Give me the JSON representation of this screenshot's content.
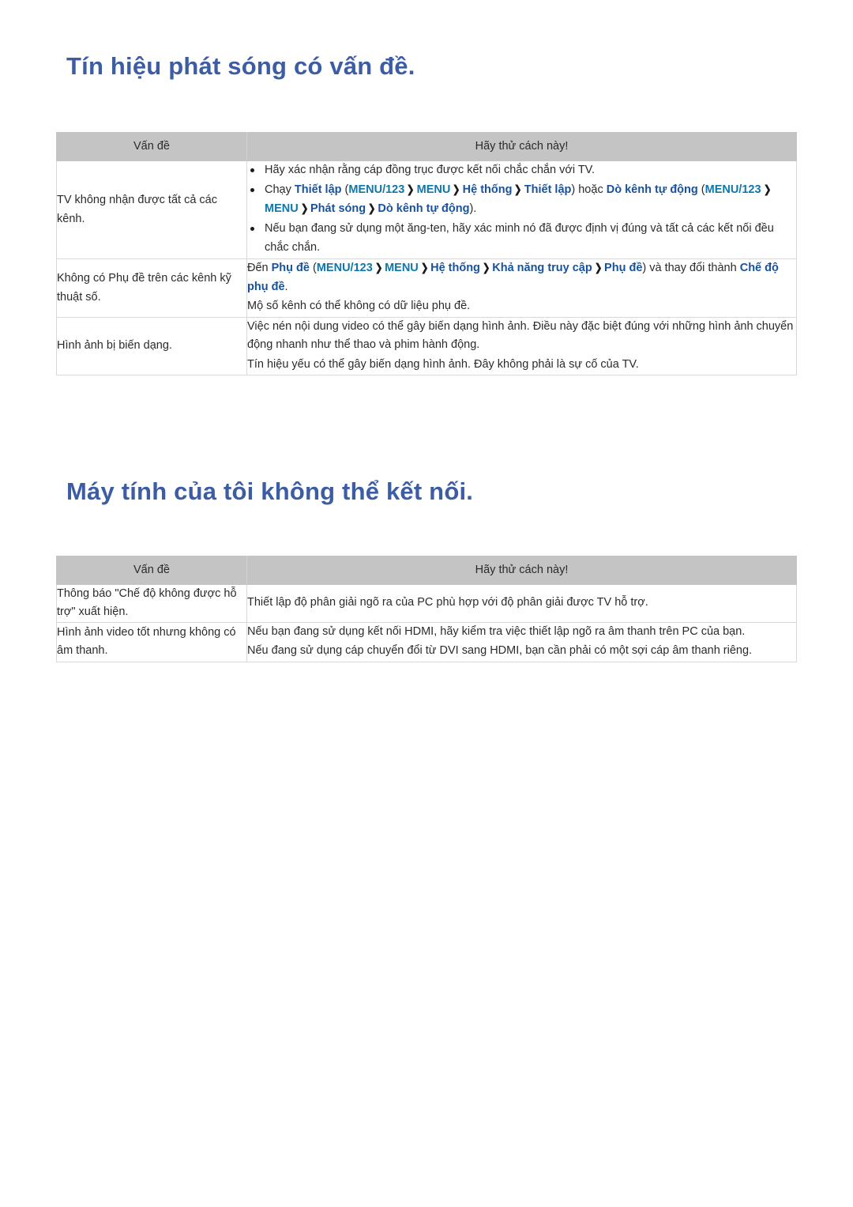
{
  "document": {
    "sections": [
      {
        "id": "broadcast",
        "heading": "Tín hiệu phát sóng có vấn đề.",
        "table": {
          "columns": [
            "Vấn đề",
            "Hãy thử cách này!"
          ],
          "rows": [
            {
              "problem": "TV không nhận được tất cả các kênh.",
              "tips": [
                {
                  "kind": "bullet",
                  "parts": [
                    {
                      "t": "plain",
                      "v": "Hãy xác nhận rằng cáp đồng trục được kết nối chắc chắn với TV."
                    }
                  ]
                },
                {
                  "kind": "bullet",
                  "parts": [
                    {
                      "t": "plain",
                      "v": "Chạy "
                    },
                    {
                      "t": "bold",
                      "v": "Thiết lập"
                    },
                    {
                      "t": "plain",
                      "v": " ("
                    },
                    {
                      "t": "teal",
                      "v": "MENU/123"
                    },
                    {
                      "t": "arrow",
                      "v": "❯"
                    },
                    {
                      "t": "teal",
                      "v": "MENU"
                    },
                    {
                      "t": "arrow",
                      "v": "❯"
                    },
                    {
                      "t": "bold",
                      "v": "Hệ thống"
                    },
                    {
                      "t": "arrow",
                      "v": "❯"
                    },
                    {
                      "t": "bold",
                      "v": "Thiết lập"
                    },
                    {
                      "t": "plain",
                      "v": ") hoặc "
                    },
                    {
                      "t": "bold",
                      "v": "Dò kênh tự động"
                    },
                    {
                      "t": "plain",
                      "v": " ("
                    },
                    {
                      "t": "teal",
                      "v": "MENU/123"
                    },
                    {
                      "t": "arrow",
                      "v": "❯"
                    },
                    {
                      "t": "teal",
                      "v": "MENU"
                    },
                    {
                      "t": "arrow",
                      "v": "❯"
                    },
                    {
                      "t": "bold",
                      "v": "Phát sóng"
                    },
                    {
                      "t": "arrow",
                      "v": "❯"
                    },
                    {
                      "t": "bold",
                      "v": "Dò kênh tự động"
                    },
                    {
                      "t": "plain",
                      "v": ")."
                    }
                  ]
                },
                {
                  "kind": "bullet",
                  "parts": [
                    {
                      "t": "plain",
                      "v": "Nếu bạn đang sử dụng một ăng-ten, hãy xác minh nó đã được định vị đúng và tất cả các kết nối đều chắc chắn."
                    }
                  ]
                }
              ]
            },
            {
              "problem": "Không có Phụ đề trên các kênh kỹ thuật số.",
              "tips": [
                {
                  "kind": "plain",
                  "parts": [
                    {
                      "t": "plain",
                      "v": "Đến "
                    },
                    {
                      "t": "bold",
                      "v": "Phụ đề"
                    },
                    {
                      "t": "plain",
                      "v": " ("
                    },
                    {
                      "t": "teal",
                      "v": "MENU/123"
                    },
                    {
                      "t": "arrow",
                      "v": "❯"
                    },
                    {
                      "t": "teal",
                      "v": "MENU"
                    },
                    {
                      "t": "arrow",
                      "v": "❯"
                    },
                    {
                      "t": "bold",
                      "v": "Hệ thống"
                    },
                    {
                      "t": "arrow",
                      "v": "❯"
                    },
                    {
                      "t": "bold",
                      "v": "Khả năng truy cập"
                    },
                    {
                      "t": "arrow",
                      "v": "❯"
                    },
                    {
                      "t": "bold",
                      "v": "Phụ đề"
                    },
                    {
                      "t": "plain",
                      "v": ") và thay đổi thành "
                    },
                    {
                      "t": "bold",
                      "v": "Chế độ phụ đề"
                    },
                    {
                      "t": "plain",
                      "v": "."
                    }
                  ]
                },
                {
                  "kind": "plain",
                  "parts": [
                    {
                      "t": "plain",
                      "v": "Mộ số kênh có thể không có dữ liệu phụ đề."
                    }
                  ]
                }
              ]
            },
            {
              "problem": "Hình ảnh bị biến dạng.",
              "tips": [
                {
                  "kind": "plain",
                  "parts": [
                    {
                      "t": "plain",
                      "v": "Việc nén nội dung video có thể gây biến dạng hình ảnh. Điều này đặc biệt đúng với những hình ảnh chuyển động nhanh như thể thao và phim hành động."
                    }
                  ]
                },
                {
                  "kind": "plain",
                  "parts": [
                    {
                      "t": "plain",
                      "v": "Tín hiệu yếu có thể gây biến dạng hình ảnh. Đây không phải là sự cố của TV."
                    }
                  ]
                }
              ]
            }
          ]
        }
      },
      {
        "id": "pc",
        "heading": "Máy tính của tôi không thể kết nối.",
        "table": {
          "columns": [
            "Vấn đề",
            "Hãy thử cách này!"
          ],
          "rows": [
            {
              "problem": "Thông báo \"Chế độ không được hỗ trợ\" xuất hiện.",
              "tips": [
                {
                  "kind": "plain",
                  "parts": [
                    {
                      "t": "plain",
                      "v": "Thiết lập độ phân giải ngõ ra của PC phù hợp với độ phân giải được TV hỗ trợ."
                    }
                  ]
                }
              ]
            },
            {
              "problem": "Hình ảnh video tốt nhưng không có âm thanh.",
              "tips": [
                {
                  "kind": "plain",
                  "parts": [
                    {
                      "t": "plain",
                      "v": "Nếu bạn đang sử dụng kết nối HDMI, hãy kiểm tra việc thiết lập ngõ ra âm thanh trên PC của bạn."
                    }
                  ]
                },
                {
                  "kind": "plain",
                  "parts": [
                    {
                      "t": "plain",
                      "v": "Nếu đang sử dụng cáp chuyển đổi từ DVI sang HDMI, bạn cần phải có một sợi cáp âm thanh riêng."
                    }
                  ]
                }
              ]
            }
          ]
        }
      }
    ],
    "colors": {
      "heading": "#3c5ca4",
      "menu_bold": "#18529c",
      "menu_teal": "#0d76ab",
      "table_header_bg": "#c4c4c4",
      "table_border": "#d9d9d9",
      "body_text": "#2b2b2b"
    }
  }
}
